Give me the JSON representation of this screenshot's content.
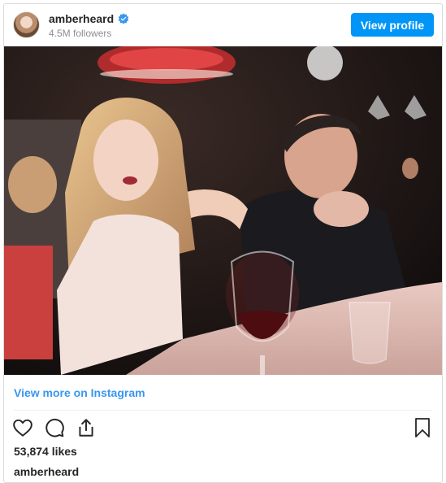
{
  "post": {
    "username": "amberheard",
    "followers": "4.5M followers",
    "view_profile_label": "View profile",
    "view_more_label": "View more on Instagram",
    "likes": "53,874 likes",
    "caption_username": "amberheard"
  },
  "icons": {
    "verified": "verified-badge-icon",
    "like": "heart-icon",
    "comment": "comment-icon",
    "share": "share-icon",
    "save": "bookmark-icon"
  },
  "colors": {
    "accent": "#0095f6",
    "link": "#3897f0",
    "text": "#262626",
    "muted": "#8e8e8e"
  }
}
